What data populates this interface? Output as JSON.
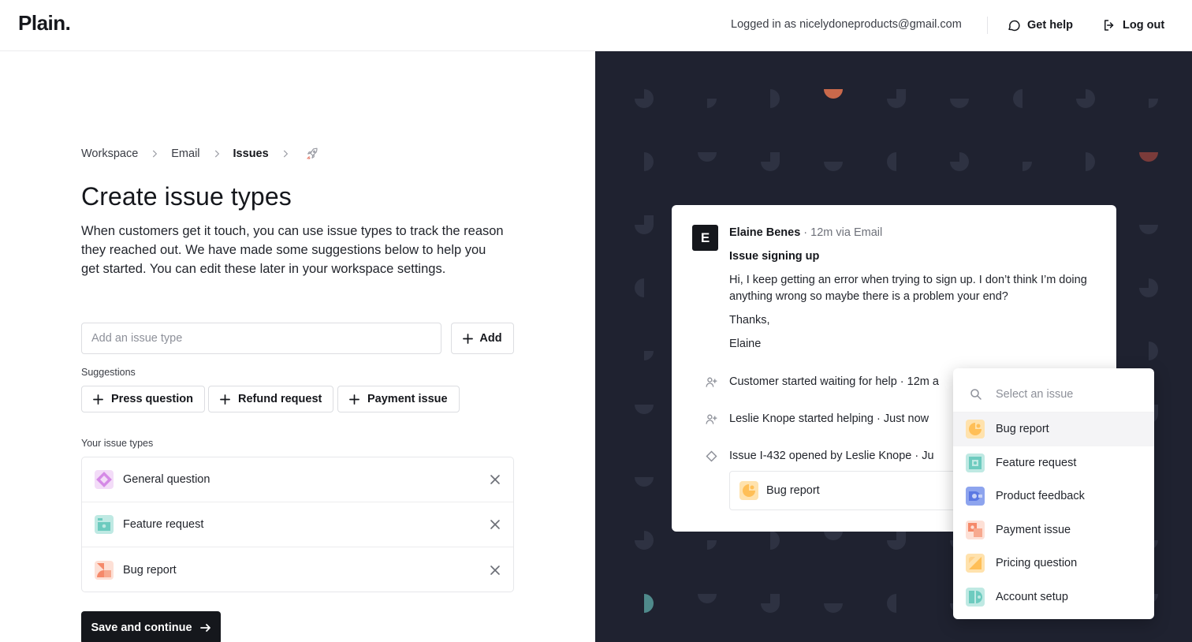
{
  "header": {
    "logo": "Plain.",
    "logged_in": "Logged in as nicelydoneproducts@gmail.com",
    "get_help": "Get help",
    "log_out": "Log out"
  },
  "breadcrumb": {
    "items": [
      "Workspace",
      "Email",
      "Issues"
    ],
    "end_icon": "rocket-icon"
  },
  "page": {
    "title": "Create issue types",
    "description": "When customers get it touch, you can use issue types to track the reason they reached out. We have made some suggestions below to help you get started. You can edit these later in your workspace settings."
  },
  "add_form": {
    "placeholder": "Add an issue type",
    "add_label": "Add"
  },
  "suggestions": {
    "label": "Suggestions",
    "items": [
      "Press question",
      "Refund request",
      "Payment issue"
    ]
  },
  "your_types": {
    "label": "Your issue types",
    "items": [
      {
        "name": "General question",
        "icon": "diamond-icon",
        "color": "#e3a8f0"
      },
      {
        "name": "Feature request",
        "icon": "box-icon",
        "color": "#8fd8cf"
      },
      {
        "name": "Bug report",
        "icon": "shapes-icon",
        "color": "#f7a98f"
      }
    ]
  },
  "save_label": "Save and continue",
  "preview": {
    "avatar": "E",
    "sender": "Elaine Benes",
    "sender_meta": "· 12m via Email",
    "subject": "Issue signing up",
    "body": [
      "Hi, I keep getting an error when trying to sign up. I don’t think I’m doing anything wrong so maybe there is a problem your end?",
      "Thanks,",
      "Elaine"
    ],
    "events": [
      {
        "text": "Customer started waiting for help",
        "meta": "· 12m a",
        "icon": "person-add-icon"
      },
      {
        "text": "Leslie Knope started helping",
        "meta": "· Just now",
        "icon": "person-add-icon"
      },
      {
        "text": "Issue I-432 opened by Leslie Knope",
        "meta": "· Ju",
        "icon": "diamond-outline-icon"
      }
    ],
    "chip": "Bug report"
  },
  "dropdown": {
    "placeholder": "Select an issue",
    "items": [
      {
        "name": "Bug report",
        "color": "#ffd28a"
      },
      {
        "name": "Feature request",
        "color": "#8fd8cf"
      },
      {
        "name": "Product feedback",
        "color": "#8da4ee"
      },
      {
        "name": "Payment issue",
        "color": "#f7a98f"
      },
      {
        "name": "Pricing question",
        "color": "#ffd28a"
      },
      {
        "name": "Account setup",
        "color": "#8fd8cf"
      }
    ]
  },
  "colors": {
    "dark_bg": "#1f2230",
    "pattern": "#2e3242",
    "accent_orange": "#c9694b",
    "accent_teal": "#4f8a8b"
  }
}
